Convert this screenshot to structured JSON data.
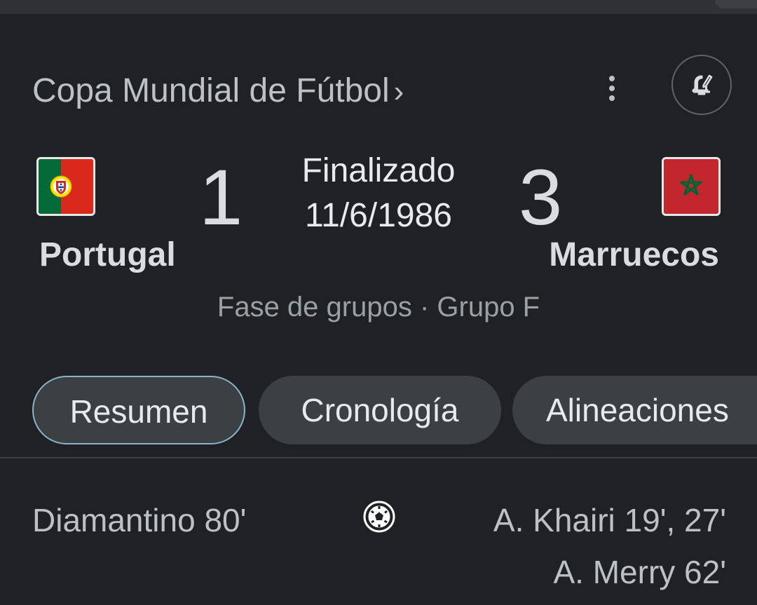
{
  "header": {
    "competition": "Copa Mundial de Fútbol",
    "chevron": "›",
    "more_icon": "more-vert-icon",
    "alert_icon": "bell-edit-icon"
  },
  "match": {
    "home": {
      "name": "Portugal",
      "score": "1",
      "flag": "portugal-flag"
    },
    "away": {
      "name": "Marruecos",
      "score": "3",
      "flag": "morocco-flag"
    },
    "status": "Finalizado",
    "date": "11/6/1986",
    "stage": "Fase de grupos · Grupo F"
  },
  "tabs": [
    {
      "label": "Resumen",
      "selected": true
    },
    {
      "label": "Cronología",
      "selected": false
    },
    {
      "label": "Alineaciones",
      "selected": false
    }
  ],
  "goals": {
    "icon": "soccer-ball-icon",
    "home": [
      "Diamantino 80'"
    ],
    "away": [
      "A. Khairi 19', 27'",
      "A. Merry 62'"
    ]
  },
  "colors": {
    "background": "#202124",
    "chip": "#3c4043",
    "selected_outline": "#8ab4c9",
    "portugal_green": "#046a38",
    "portugal_red": "#da291c",
    "morocco_red": "#c1272d",
    "morocco_star": "#006233"
  }
}
